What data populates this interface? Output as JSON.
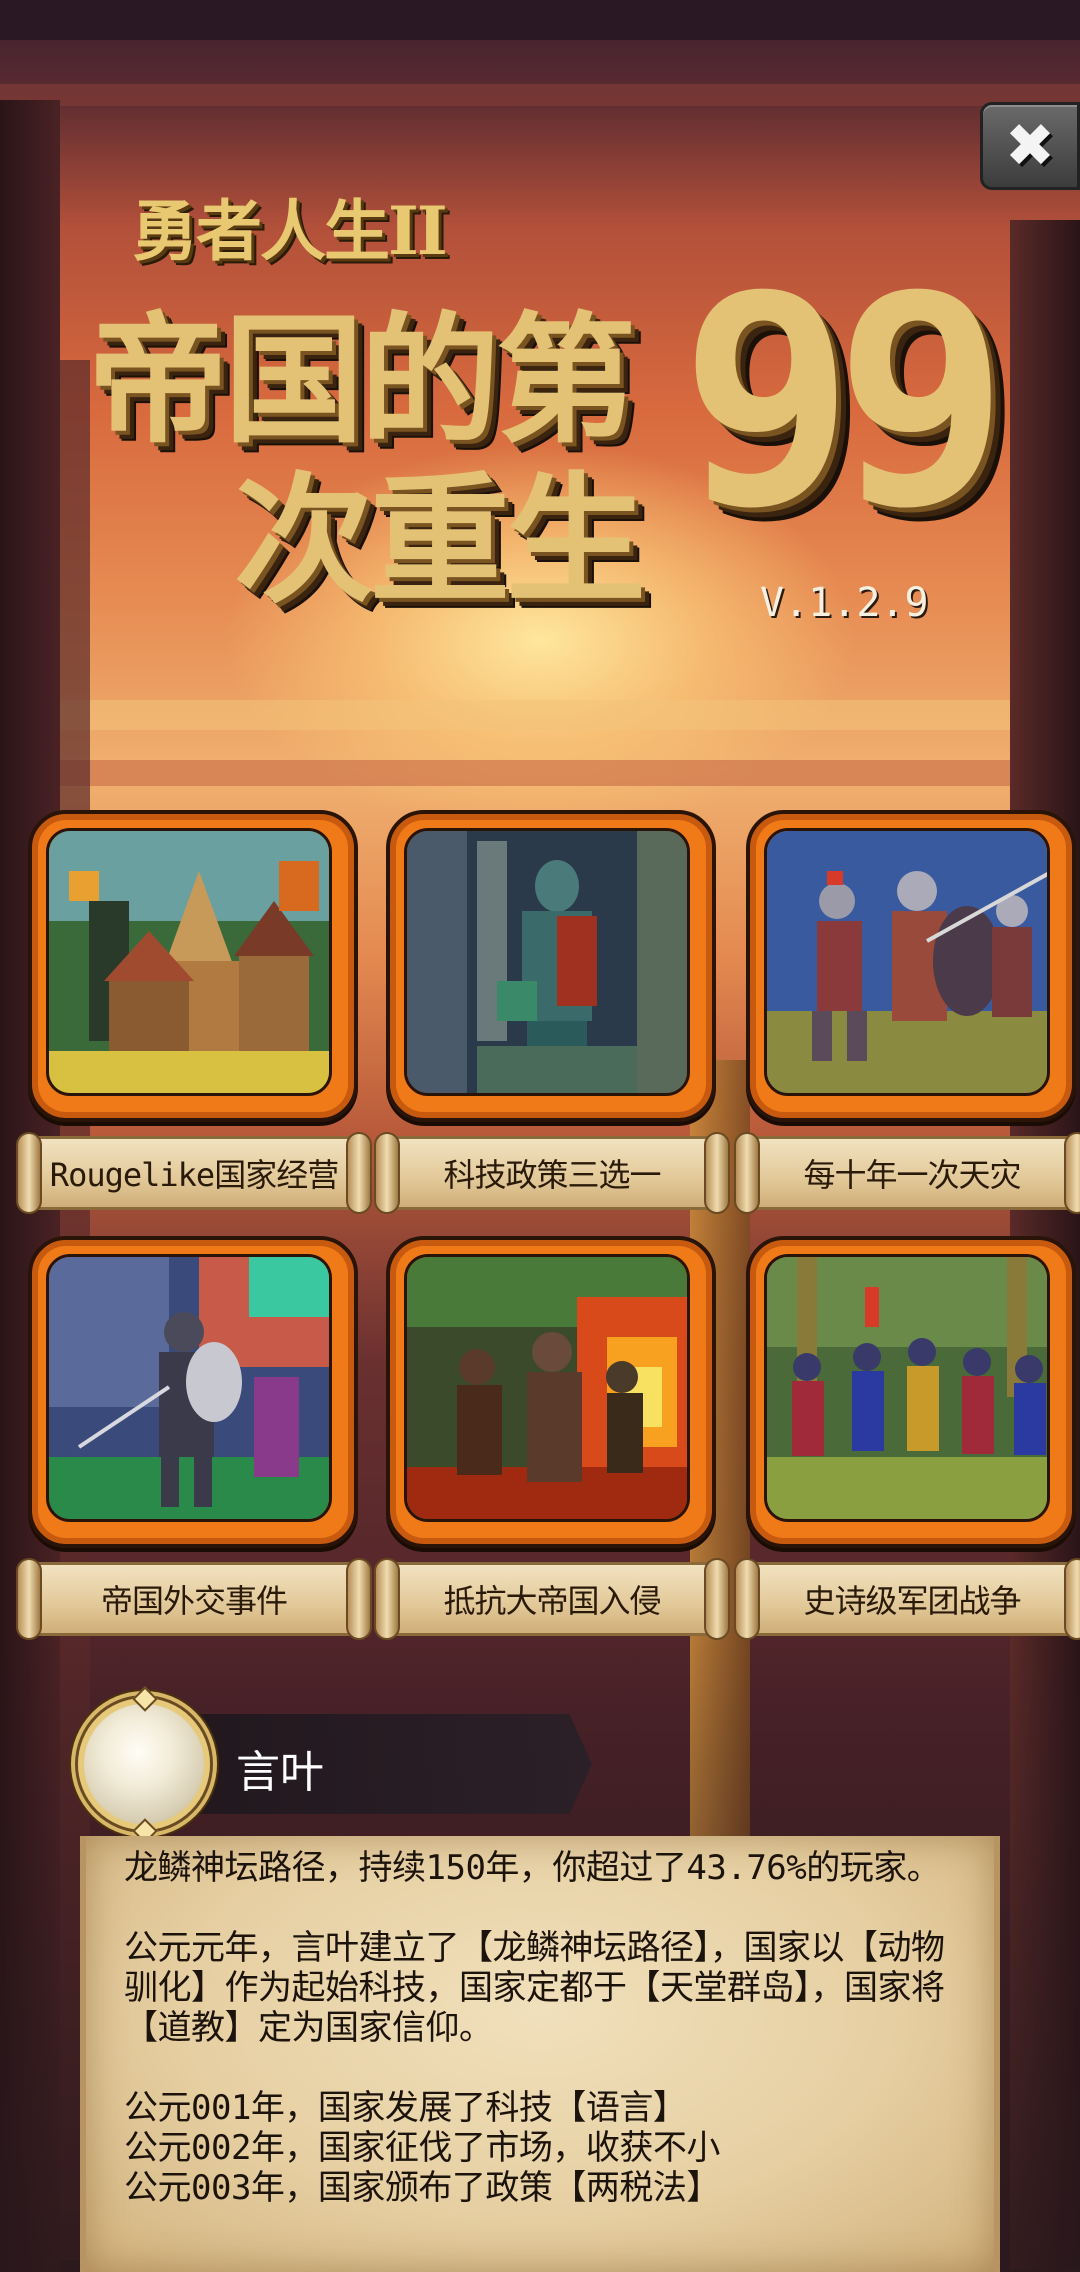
{
  "game": {
    "subtitle": "勇者人生II",
    "title_line1": "帝国的第",
    "title_line2": "次重生",
    "title_number": "99",
    "version": "V.1.2.9"
  },
  "close_button": {
    "glyph": "✖"
  },
  "features": [
    {
      "label": "Rougelike国家经营",
      "icon": "village-picture"
    },
    {
      "label": "科技政策三选一",
      "icon": "statue-picture"
    },
    {
      "label": "每十年一次天灾",
      "icon": "knights-battle-picture"
    },
    {
      "label": "帝国外交事件",
      "icon": "knight-shield-picture"
    },
    {
      "label": "抵抗大帝国入侵",
      "icon": "burning-invasion-picture"
    },
    {
      "label": "史诗级军团战争",
      "icon": "army-march-picture"
    }
  ],
  "player": {
    "name": "言叶"
  },
  "log": {
    "summary": "龙鳞神坛路径，持续150年，你超过了43.76%的玩家。",
    "founding": "公元元年，言叶建立了【龙鳞神坛路径】，国家以【动物驯化】作为起始科技，国家定都于【天堂群岛】，国家将【道教】定为国家信仰。",
    "events": [
      "公元001年，国家发展了科技【语言】",
      "公元002年，国家征伐了市场，收获不小",
      "公元003年，国家颁布了政策【两税法】"
    ]
  },
  "colors": {
    "card_frame": "#f07a18",
    "title_gold": "#e3c276",
    "parchment": "#e6cfa2"
  }
}
